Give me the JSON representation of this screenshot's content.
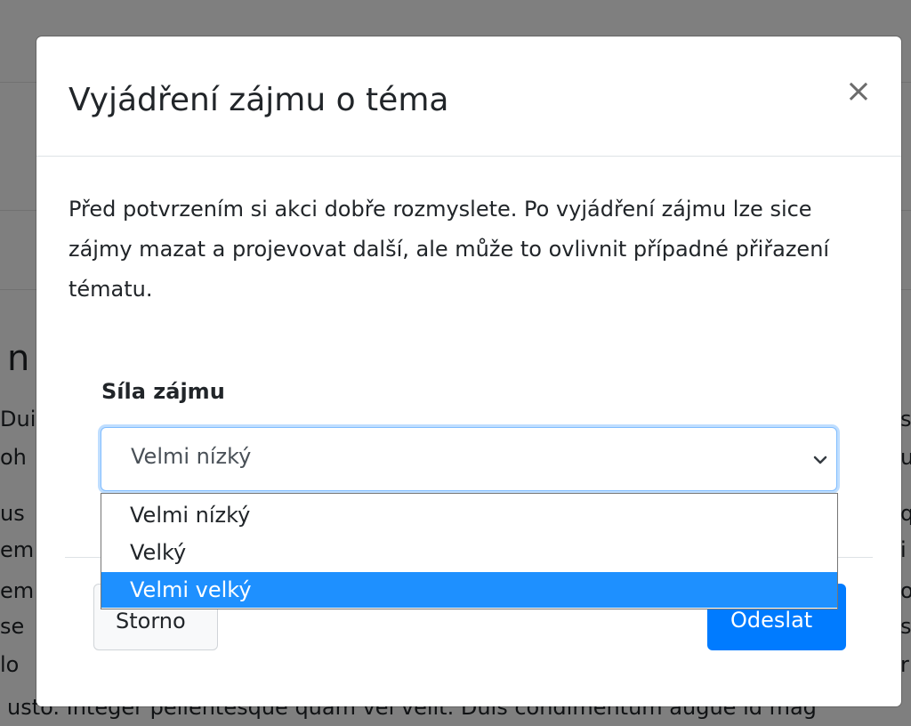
{
  "background": {
    "heading_fragment": "n",
    "left_fragments": [
      "Dui",
      "oh",
      "us",
      "em",
      "em",
      "se",
      "lo"
    ],
    "right_fragments": [
      "s",
      "u",
      "q",
      "i",
      "o",
      "s",
      "r"
    ],
    "bottom_text": "usto. Integer pellentesque quam vel velit. Duis condimentum augue id mag"
  },
  "modal": {
    "title": "Vyjádření zájmu o téma",
    "close_label": "×",
    "body_text": "Před potvrzením si akci dobře rozmyslete. Po vyjádření zájmu lze sice zájmy mazat a projevovat další, ale může to ovlivnit případné přiřazení tématu.",
    "form": {
      "label": "Síla zájmu",
      "select_value": "Velmi nízký",
      "options": [
        {
          "label": "Velmi nízký",
          "highlighted": false
        },
        {
          "label": "Velký",
          "highlighted": false
        },
        {
          "label": "Velmi velký",
          "highlighted": true
        }
      ]
    },
    "buttons": {
      "cancel": "Storno",
      "submit": "Odeslat"
    }
  },
  "colors": {
    "primary": "#007bff",
    "highlight": "#1e90ff",
    "overlay": "rgba(0,0,0,0.5)"
  }
}
